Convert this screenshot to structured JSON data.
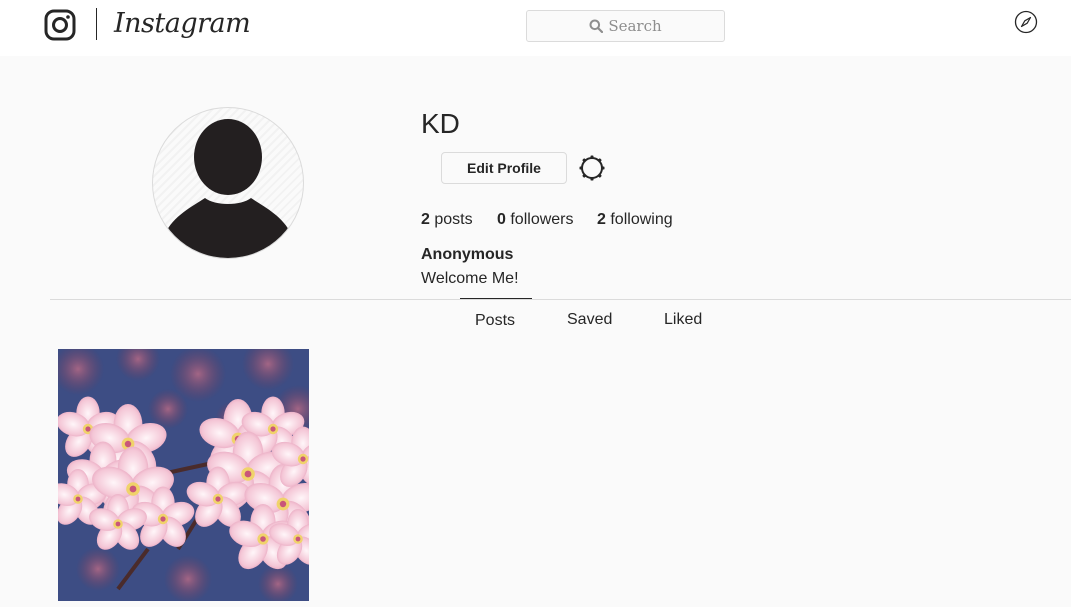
{
  "app": {
    "wordmark": "Instagram"
  },
  "header": {
    "search": {
      "placeholder": "Search",
      "icon": "search-icon"
    },
    "explore_icon": "compass-icon"
  },
  "profile": {
    "username": "KD",
    "edit_button_label": "Edit Profile",
    "settings_icon": "gear-icon",
    "stats": [
      {
        "count": "2",
        "label": "posts"
      },
      {
        "count": "0",
        "label": "followers"
      },
      {
        "count": "2",
        "label": "following"
      }
    ],
    "full_name": "Anonymous",
    "bio": "Welcome Me!"
  },
  "tabs": [
    {
      "label": "Posts",
      "active": true
    },
    {
      "label": "Saved",
      "active": false
    },
    {
      "label": "Liked",
      "active": false
    }
  ],
  "posts": [
    {
      "subject": "pink cherry blossoms"
    }
  ],
  "colors": {
    "background": "#fafafa",
    "text": "#262626",
    "border": "#dbdbdb",
    "muted": "#8e8e8e"
  }
}
